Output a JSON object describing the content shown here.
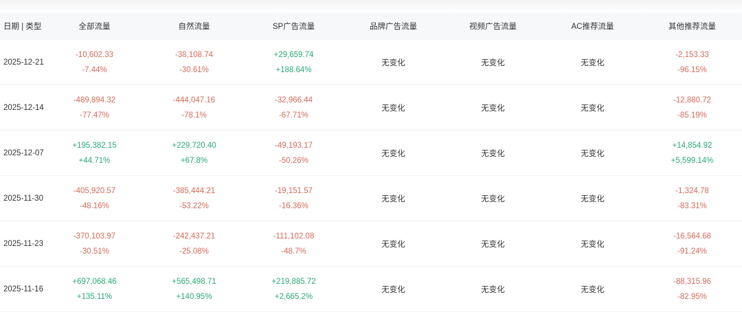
{
  "header": [
    "日期 | 类型",
    "全部流量",
    "自然流量",
    "SP广告流量",
    "品牌广告流量",
    "视频广告流量",
    "AC推荐流量",
    "其他推荐流量"
  ],
  "no_change": "无变化",
  "colors": {
    "negative": "#d46b5a",
    "positive": "#2ba876",
    "header_bg": "#f7f8fa"
  },
  "rows": [
    {
      "date": "2025-12-21",
      "cells": [
        [
          "-10,602.33",
          "-7.44%"
        ],
        [
          "-38,108.74",
          "-30.61%"
        ],
        [
          "+29,659.74",
          "+188.64%"
        ],
        null,
        null,
        null,
        [
          "-2,153.33",
          "-96.15%"
        ]
      ]
    },
    {
      "date": "2025-12-14",
      "cells": [
        [
          "-489,894.32",
          "-77.47%"
        ],
        [
          "-444,047.16",
          "-78.1%"
        ],
        [
          "-32,966.44",
          "-67.71%"
        ],
        null,
        null,
        null,
        [
          "-12,880.72",
          "-85.19%"
        ]
      ]
    },
    {
      "date": "2025-12-07",
      "cells": [
        [
          "+195,382.15",
          "+44.71%"
        ],
        [
          "+229,720.40",
          "+67.8%"
        ],
        [
          "-49,193.17",
          "-50.26%"
        ],
        null,
        null,
        null,
        [
          "+14,854.92",
          "+5,599.14%"
        ]
      ]
    },
    {
      "date": "2025-11-30",
      "cells": [
        [
          "-405,920.57",
          "-48.16%"
        ],
        [
          "-385,444.21",
          "-53.22%"
        ],
        [
          "-19,151.57",
          "-16.36%"
        ],
        null,
        null,
        null,
        [
          "-1,324.78",
          "-83.31%"
        ]
      ]
    },
    {
      "date": "2025-11-23",
      "cells": [
        [
          "-370,103.97",
          "-30.51%"
        ],
        [
          "-242,437.21",
          "-25.08%"
        ],
        [
          "-111,102.08",
          "-48.7%"
        ],
        null,
        null,
        null,
        [
          "-16,564.68",
          "-91.24%"
        ]
      ]
    },
    {
      "date": "2025-11-16",
      "cells": [
        [
          "+697,068.46",
          "+135.11%"
        ],
        [
          "+565,498.71",
          "+140.95%"
        ],
        [
          "+219,885.72",
          "+2,665.2%"
        ],
        null,
        null,
        null,
        [
          "-88,315.96",
          "-82.95%"
        ]
      ]
    }
  ]
}
